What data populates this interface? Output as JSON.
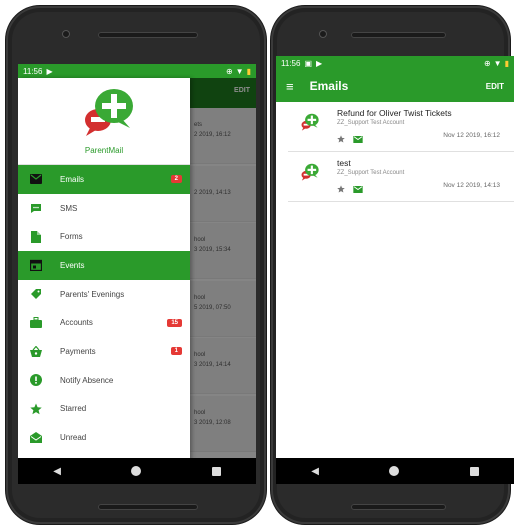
{
  "colors": {
    "brand": "#2a9a2a",
    "badge": "#e53935"
  },
  "left_phone": {
    "status_time": "11:56",
    "background_list": {
      "edit_label": "EDIT",
      "rows": [
        {
          "line1": "ets",
          "line2": "2 2019, 16:12"
        },
        {
          "line1": "",
          "line2": "2 2019, 14:13"
        },
        {
          "line1": "hool",
          "line2": "3 2019, 15:34"
        },
        {
          "line1": "hool",
          "line2": "5 2019, 07:50"
        },
        {
          "line1": "hool",
          "line2": "3 2019, 14:14"
        },
        {
          "line1": "hool",
          "line2": "3 2019, 12:08"
        }
      ]
    },
    "drawer": {
      "brand": "ParentMail",
      "items": [
        {
          "label": "Emails",
          "icon": "mail-icon",
          "badge": "2",
          "active": true
        },
        {
          "label": "SMS",
          "icon": "sms-icon",
          "badge": "",
          "active": false
        },
        {
          "label": "Forms",
          "icon": "forms-icon",
          "badge": "",
          "active": false
        },
        {
          "label": "Events",
          "icon": "calendar-icon",
          "badge": "",
          "active": true
        },
        {
          "label": "Parents' Evenings",
          "icon": "tag-icon",
          "badge": "",
          "active": false
        },
        {
          "label": "Accounts",
          "icon": "briefcase-icon",
          "badge": "15",
          "active": false
        },
        {
          "label": "Payments",
          "icon": "basket-icon",
          "badge": "1",
          "active": false
        },
        {
          "label": "Notify Absence",
          "icon": "alert-icon",
          "badge": "",
          "active": false
        },
        {
          "label": "Starred",
          "icon": "star-icon",
          "badge": "",
          "active": false
        },
        {
          "label": "Unread",
          "icon": "open-mail-icon",
          "badge": "",
          "active": false
        }
      ]
    }
  },
  "right_phone": {
    "status_time": "11:56",
    "title": "Emails",
    "edit_label": "EDIT",
    "emails": [
      {
        "subject": "Refund for Oliver Twist Tickets",
        "sender": "ZZ_Support Test Account",
        "date": "Nov 12 2019, 16:12"
      },
      {
        "subject": "test",
        "sender": "ZZ_Support Test Account",
        "date": "Nov 12 2019, 14:13"
      }
    ]
  }
}
